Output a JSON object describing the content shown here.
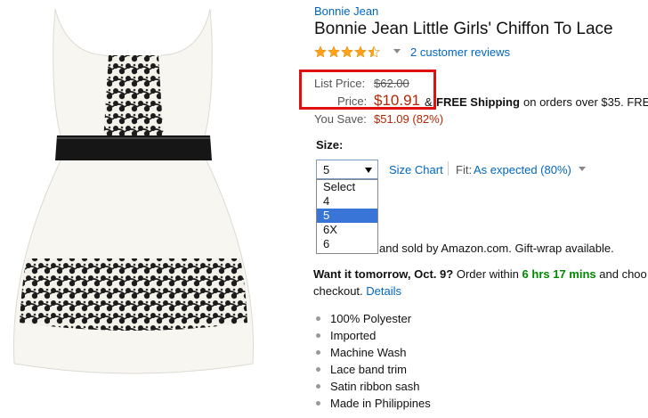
{
  "brand": "Bonnie Jean",
  "title": "Bonnie Jean Little Girls' Chiffon To Lace",
  "rating": {
    "stars": 4.5,
    "reviews_link": "2 customer reviews"
  },
  "pricing": {
    "list_price_label": "List Price:",
    "list_price": "$62.00",
    "price_label": "Price:",
    "price": "$10.91",
    "amp": "&",
    "free_shipping": "FREE Shipping",
    "shipping_rest": "on orders over $35. FRE",
    "you_save_label": "You Save:",
    "you_save": "$51.09 (82%)"
  },
  "size": {
    "label": "Size:",
    "selected": "5",
    "options": [
      "Select",
      "4",
      "5",
      "6X",
      "6"
    ],
    "size_chart_link": "Size Chart",
    "fit_label": "Fit:",
    "fit_value": "As expected (80%)"
  },
  "sold_by": "and sold by Amazon.com. Gift-wrap available.",
  "delivery": {
    "want": "Want it tomorrow, Oct. 9?",
    "order_within": "Order within",
    "time": "6 hrs 17 mins",
    "and_choose": "and choo",
    "checkout": "checkout.",
    "details": "Details"
  },
  "features": [
    "100% Polyester",
    "Imported",
    "Machine Wash",
    "Lace band trim",
    "Satin ribbon sash",
    "Made in Philippines"
  ],
  "colors": {
    "link": "#0066c0",
    "price": "#b12704",
    "highlight_box": "#e01010",
    "time": "#008a00",
    "select_highlight": "#3875d7"
  }
}
